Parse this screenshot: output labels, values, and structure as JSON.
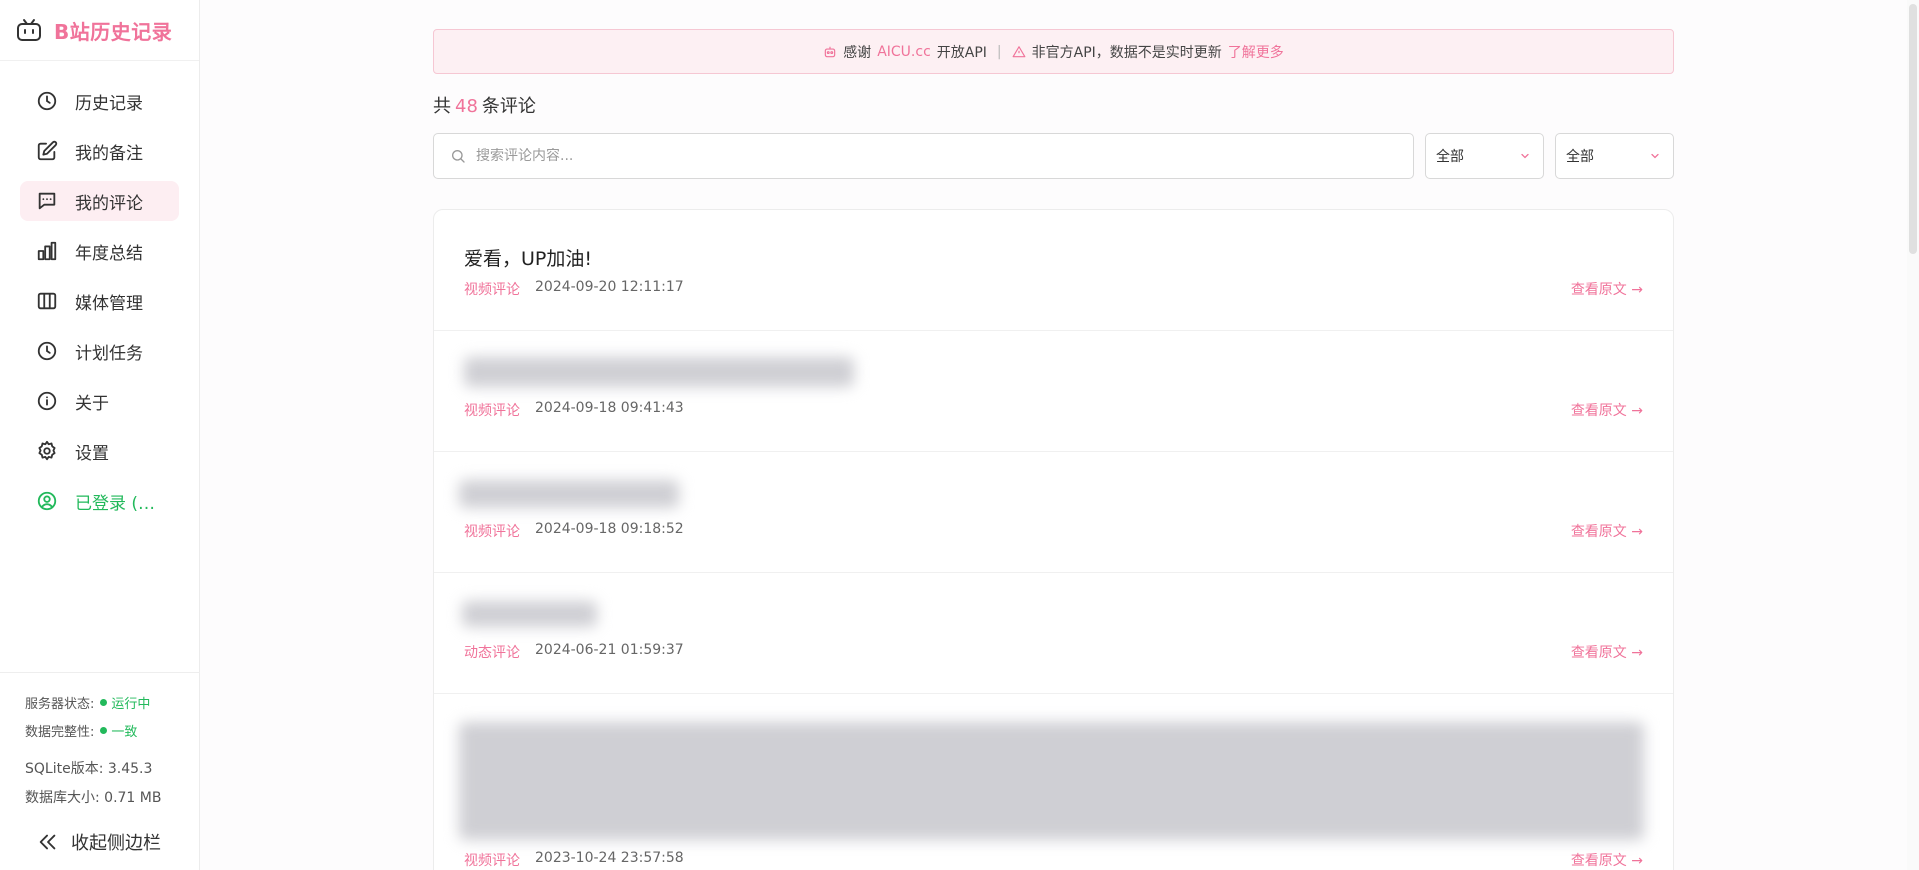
{
  "brand": {
    "title": "B站历史记录"
  },
  "sidebar": {
    "items": [
      {
        "label": "历史记录",
        "icon": "clock-icon"
      },
      {
        "label": "我的备注",
        "icon": "edit-icon"
      },
      {
        "label": "我的评论",
        "icon": "comment-icon",
        "active": true
      },
      {
        "label": "年度总结",
        "icon": "bar-chart-icon"
      },
      {
        "label": "媒体管理",
        "icon": "library-icon"
      },
      {
        "label": "计划任务",
        "icon": "clock-icon"
      },
      {
        "label": "关于",
        "icon": "info-icon"
      },
      {
        "label": "设置",
        "icon": "gear-icon"
      },
      {
        "label": "已登录 (…",
        "icon": "user-circle-icon"
      }
    ],
    "status": {
      "server_label": "服务器状态:",
      "server_value": "运行中",
      "integrity_label": "数据完整性:",
      "integrity_value": "一致",
      "sqlite": "SQLite版本: 3.45.3",
      "dbsize": "数据库大小: 0.71 MB"
    },
    "collapse_label": "收起侧边栏"
  },
  "notice": {
    "thanks": "感谢",
    "brand": "AICU.cc",
    "api": "开放API",
    "separator": "|",
    "warning": "非官方API，数据不是实时更新",
    "learn_more": "了解更多"
  },
  "summary": {
    "prefix": "共",
    "count": "48",
    "suffix": "条评论"
  },
  "search": {
    "placeholder": "搜索评论内容..."
  },
  "filters": {
    "type_value": "全部",
    "sort_value": "全部"
  },
  "comments": [
    {
      "content": "爱看，UP加油!",
      "type": "视频评论",
      "time": "2024-09-20 12:11:17",
      "view": "查看原文 →"
    },
    {
      "content": "",
      "type": "视频评论",
      "time": "2024-09-18 09:41:43",
      "view": "查看原文 →"
    },
    {
      "content": "",
      "type": "视频评论",
      "time": "2024-09-18 09:18:52",
      "view": "查看原文 →"
    },
    {
      "content": "",
      "type": "动态评论",
      "time": "2024-06-21 01:59:37",
      "view": "查看原文 →"
    },
    {
      "content": "",
      "type": "视频评论",
      "time": "2023-10-24 23:57:58",
      "view": "查看原文 →"
    }
  ],
  "colors": {
    "accent": "#f0739a",
    "success": "#22b95b",
    "active_bg": "#fdeef2",
    "notice_bg": "#fdf0f3"
  }
}
